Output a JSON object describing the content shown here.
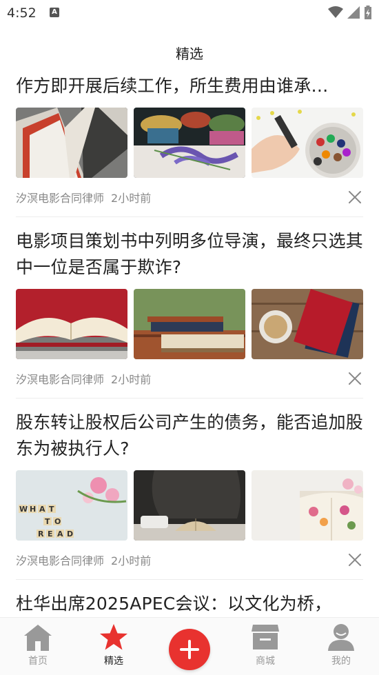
{
  "status": {
    "time": "4:52",
    "notification_letter": "A"
  },
  "header": {
    "title": "精选"
  },
  "articles": [
    {
      "title": "作方即开展后续工作，所生费用由谁承…",
      "author": "汐溟电影合同律师",
      "time": "2小时前",
      "thumbs": [
        "books-spines-image",
        "cupcakes-flowers-image",
        "crayons-hand-image"
      ]
    },
    {
      "title": "电影项目策划书中列明多位导演，最终只选其中一位是否属于欺诈?",
      "author": "汐溟电影合同律师",
      "time": "2小时前",
      "thumbs": [
        "open-book-red-image",
        "books-bench-image",
        "notebook-coffee-image"
      ]
    },
    {
      "title": "股东转让股权后公司产生的债务，能否追加股东为被执行人?",
      "author": "汐溟电影合同律师",
      "time": "2小时前",
      "thumbs": [
        "what-to-read-tiles-image",
        "book-teacup-chair-image",
        "floral-book-image"
      ]
    },
    {
      "title": "杜华出席2025APEC会议：以文化为桥，"
    }
  ],
  "nav": {
    "home": "首页",
    "featured": "精选",
    "mall": "商城",
    "mine": "我的"
  },
  "colors": {
    "accent": "#e8322f",
    "nav_inactive": "#999999"
  }
}
